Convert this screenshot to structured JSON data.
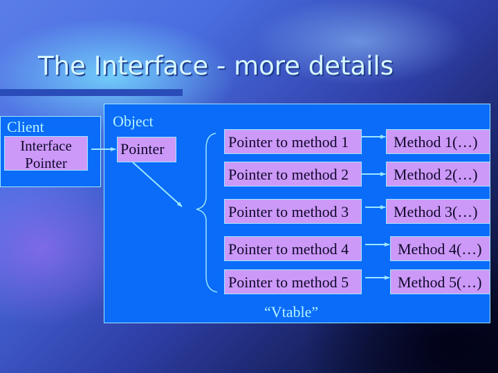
{
  "slide": {
    "title": "The Interface - more details"
  },
  "client": {
    "label": "Client",
    "interface_pointer_line1": "Interface",
    "interface_pointer_line2": "Pointer"
  },
  "object": {
    "label": "Object",
    "pointer_label": "Pointer",
    "vtable_label": "“Vtable”",
    "vtable_entries": [
      {
        "pointer": "Pointer to method 1",
        "method": "Method 1(…)"
      },
      {
        "pointer": "Pointer to method 2",
        "method": "Method 2(…)"
      },
      {
        "pointer": "Pointer to method 3",
        "method": "Method 3(…)"
      },
      {
        "pointer": "Pointer to method 4",
        "method": "Method 4(…)"
      },
      {
        "pointer": "Pointer to method 5",
        "method": "Method 5(…)"
      }
    ]
  },
  "colors": {
    "container_fill": "#0a6cf8",
    "entry_fill": "#cc99f8",
    "outline_and_arrows": "#9fe8ff",
    "title_text": "#d8f8ff"
  }
}
